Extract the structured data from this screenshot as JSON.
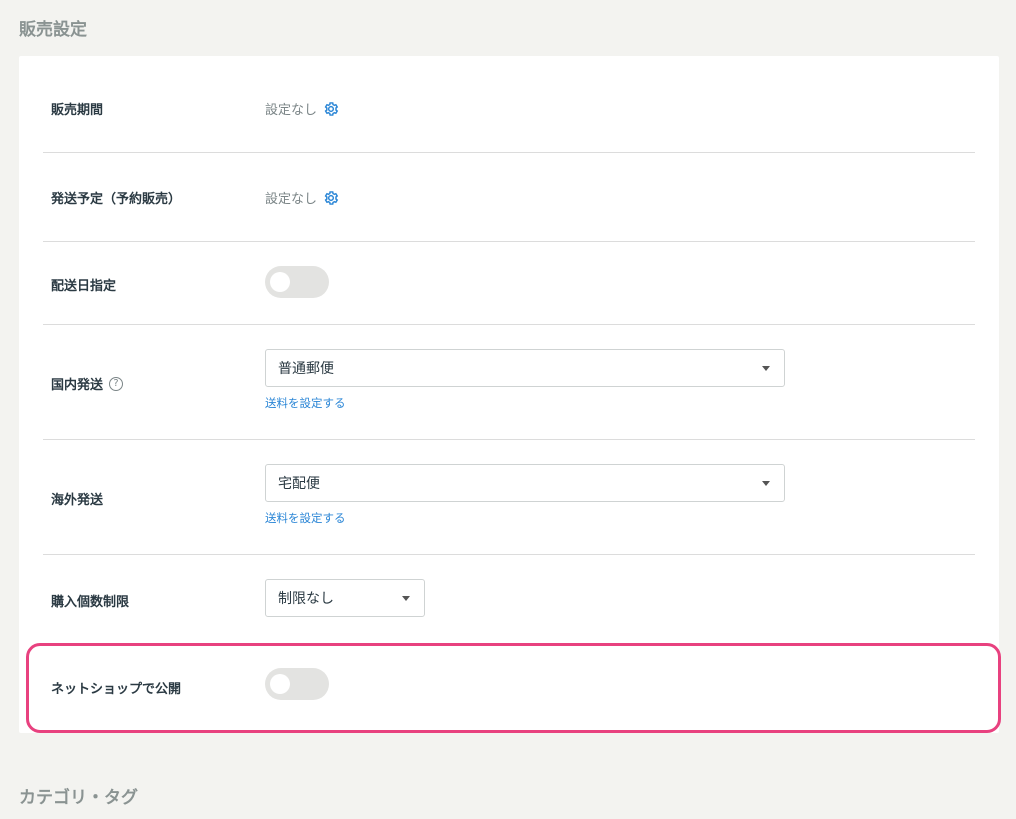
{
  "sections": {
    "sales_settings_title": "販売設定",
    "category_tag_title": "カテゴリ・タグ"
  },
  "rows": {
    "sales_period": {
      "label": "販売期間",
      "value": "設定なし"
    },
    "shipping_schedule": {
      "label": "発送予定（予約販売）",
      "value": "設定なし"
    },
    "delivery_date": {
      "label": "配送日指定",
      "toggle_on": false
    },
    "domestic_shipping": {
      "label": "国内発送",
      "select_value": "普通郵便",
      "link": "送料を設定する"
    },
    "international_shipping": {
      "label": "海外発送",
      "select_value": "宅配便",
      "link": "送料を設定する"
    },
    "purchase_limit": {
      "label": "購入個数制限",
      "select_value": "制限なし"
    },
    "netshop_publish": {
      "label": "ネットショップで公開",
      "toggle_on": false
    }
  },
  "colors": {
    "accent_link": "#2b86d6",
    "highlight": "#e8417f",
    "background": "#f3f3f0"
  },
  "icons": {
    "settings": "gear-icon",
    "help": "help-circle-icon",
    "dropdown": "chevron-down-icon"
  }
}
